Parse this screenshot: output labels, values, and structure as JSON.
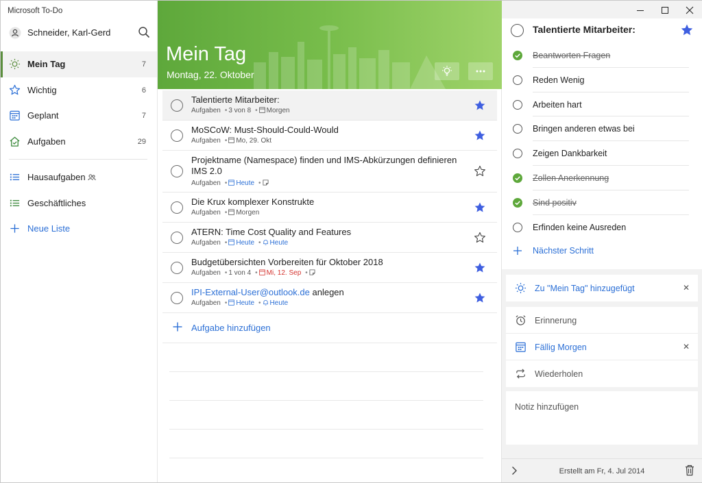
{
  "window": {
    "title": "Microsoft To-Do"
  },
  "sidebar": {
    "user_name": "Schneider, Karl-Gerd",
    "nav": [
      {
        "label": "Mein Tag",
        "count": "7",
        "icon": "sun-icon"
      },
      {
        "label": "Wichtig",
        "count": "6",
        "icon": "star-icon"
      },
      {
        "label": "Geplant",
        "count": "7",
        "icon": "calendar-icon"
      },
      {
        "label": "Aufgaben",
        "count": "29",
        "icon": "house-icon"
      }
    ],
    "lists": [
      {
        "label": "Hausaufgaben",
        "icon": "list-icon"
      },
      {
        "label": "Geschäftliches",
        "icon": "list-icon"
      }
    ],
    "new_list": "Neue Liste"
  },
  "header": {
    "title": "Mein Tag",
    "date": "Montag, 22. Oktober"
  },
  "tasks": [
    {
      "title": "Talentierte Mitarbeiter:",
      "list": "Aufgaben",
      "progress": "3 von 8",
      "due": "Morgen",
      "starred": true
    },
    {
      "title": "MoSCoW: Must-Should-Could-Would",
      "list": "Aufgaben",
      "due": "Mo, 29. Okt",
      "starred": true
    },
    {
      "title": "Projektname (Namespace) finden und IMS-Abkürzungen definieren IMS 2.0",
      "list": "Aufgaben",
      "due": "Heute",
      "starred": false
    },
    {
      "title": "Die Krux komplexer Konstrukte",
      "list": "Aufgaben",
      "due": "Morgen",
      "starred": true
    },
    {
      "title": "ATERN: Time Cost Quality and Features",
      "list": "Aufgaben",
      "due": "Heute",
      "reminder": "Heute",
      "starred": false
    },
    {
      "title": "Budgetübersichten Vorbereiten für Oktober 2018",
      "list": "Aufgaben",
      "progress": "1 von 4",
      "due": "Mi, 12. Sep",
      "starred": true
    },
    {
      "title_link": "IPI-External-User@outlook.de",
      "title_rest": " anlegen",
      "list": "Aufgaben",
      "due": "Heute",
      "reminder": "Heute",
      "starred": true
    }
  ],
  "add_task": "Aufgabe hinzufügen",
  "detail": {
    "title": "Talentierte Mitarbeiter:",
    "steps": [
      {
        "label": "Beantworten Fragen",
        "done": true
      },
      {
        "label": "Reden Wenig",
        "done": false
      },
      {
        "label": "Arbeiten hart",
        "done": false
      },
      {
        "label": "Bringen anderen etwas bei",
        "done": false
      },
      {
        "label": "Zeigen Dankbarkeit",
        "done": false
      },
      {
        "label": "Zollen Anerkennung",
        "done": true
      },
      {
        "label": "Sind positiv",
        "done": true
      },
      {
        "label": "Erfinden keine Ausreden",
        "done": false
      }
    ],
    "next_step": "Nächster Schritt",
    "my_day": "Zu \"Mein Tag\" hinzugefügt",
    "reminder": "Erinnerung",
    "due": "Fällig Morgen",
    "repeat": "Wiederholen",
    "note_placeholder": "Notiz hinzufügen",
    "created": "Erstellt am Fr, 4. Jul 2014"
  },
  "colors": {
    "accent_blue": "#2b6fd6",
    "star_blue": "#3f5fe0",
    "green": "#5ea83b",
    "check_green": "#5ea83b",
    "due_red": "#d4322d"
  }
}
